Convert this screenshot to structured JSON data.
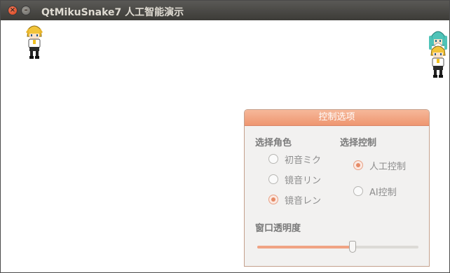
{
  "window": {
    "title": "QtMikuSnake7 人工智能演示",
    "close_glyph": "×",
    "minimize_glyph": "–"
  },
  "panel": {
    "title": "控制选项",
    "role_group": {
      "title": "选择角色",
      "options": [
        {
          "label": "初音ミク",
          "selected": false
        },
        {
          "label": "镜音リン",
          "selected": false
        },
        {
          "label": "镜音レン",
          "selected": true
        }
      ]
    },
    "control_group": {
      "title": "选择控制",
      "options": [
        {
          "label": "人工控制",
          "selected": true
        },
        {
          "label": "AI控制",
          "selected": false
        }
      ]
    },
    "opacity": {
      "label": "窗口透明度",
      "value_fraction": 0.59
    }
  },
  "colors": {
    "accent": "#ee9670",
    "titlebar": "#3c3b37"
  }
}
